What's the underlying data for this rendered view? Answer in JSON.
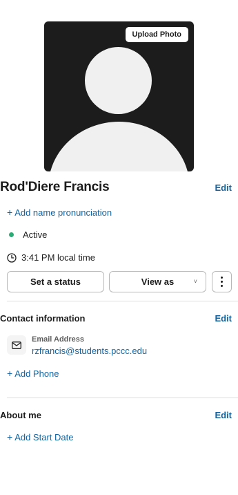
{
  "profile": {
    "upload_photo_label": "Upload Photo",
    "name": "Rod'Diere Francis",
    "edit_label": "Edit",
    "add_name_pronunciation": "Add name pronunciation",
    "presence": "Active",
    "presence_color": "#2bac76",
    "local_time": "3:41 PM local time"
  },
  "actions": {
    "set_status": "Set a status",
    "view_as": "View as",
    "view_as_chevron": "˅"
  },
  "contact": {
    "title": "Contact information",
    "edit_label": "Edit",
    "email_label": "Email Address",
    "email_value": "rzfrancis@students.pccc.edu",
    "add_phone": "Add Phone"
  },
  "about": {
    "title": "About me",
    "edit_label": "Edit",
    "add_start_date": "Add Start Date"
  },
  "icons": {
    "add": "+",
    "clock": "clock-icon",
    "mail": "envelope-icon",
    "more": "vertical-ellipsis-icon"
  },
  "colors": {
    "link": "#1264a3",
    "text": "#1d1c1d",
    "avatar_bg": "#1d1c1d"
  }
}
